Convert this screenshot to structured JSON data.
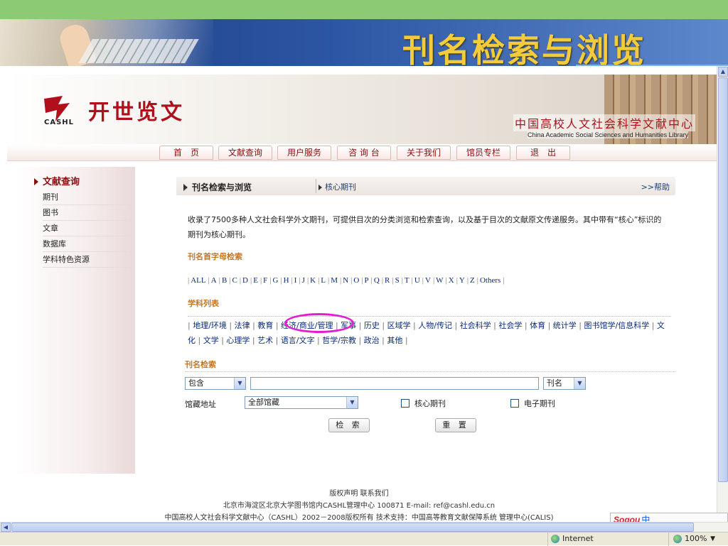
{
  "slide": {
    "title": "刊名检索与浏览"
  },
  "site": {
    "logo_text": "开世览文",
    "logo_sub": "CASHL",
    "center_name": "中国高校人文社会科学文献中心",
    "center_en": "China Academic Social Sciences and Humanities Library"
  },
  "nav": [
    {
      "label": "首　页"
    },
    {
      "label": "文献查询"
    },
    {
      "label": "用户服务"
    },
    {
      "label": "咨 询 台"
    },
    {
      "label": "关于我们"
    },
    {
      "label": "馆员专栏"
    },
    {
      "label": "退　出"
    }
  ],
  "sidebar": {
    "title": "文献查询",
    "items": [
      {
        "label": "期刊"
      },
      {
        "label": "图书"
      },
      {
        "label": "文章"
      },
      {
        "label": "数据库"
      },
      {
        "label": "学科特色资源"
      }
    ]
  },
  "panel": {
    "title": "刊名检索与浏览",
    "subtitle": "核心期刊",
    "help": ">>帮助",
    "intro": "收录了7500多种人文社会科学外文期刊，可提供目次的分类浏览和检索查询，以及基于目次的文献原文传递服务。其中带有“核心”标识的期刊为核心期刊。"
  },
  "letter_section": {
    "title": "刊名首字母检索",
    "letters": [
      "ALL",
      "A",
      "B",
      "C",
      "D",
      "E",
      "F",
      "G",
      "H",
      "I",
      "J",
      "K",
      "L",
      "M",
      "N",
      "O",
      "P",
      "Q",
      "R",
      "S",
      "T",
      "U",
      "V",
      "W",
      "X",
      "Y",
      "Z",
      "Others"
    ]
  },
  "subject_section": {
    "title": "学科列表",
    "subjects": [
      "地理/环境",
      "法律",
      "教育",
      "经济/商业/管理",
      "军事",
      "历史",
      "区域学",
      "人物/传记",
      "社会科学",
      "社会学",
      "体育",
      "统计学",
      "图书馆学/信息科学",
      "文化",
      "文学",
      "心理学",
      "艺术",
      "语言/文字",
      "哲学/宗教",
      "政治",
      "其他"
    ]
  },
  "search": {
    "title": "刊名检索",
    "match_select": "包含",
    "field_select": "刊名",
    "query_value": "",
    "location_label": "馆藏地址",
    "location_select": "全部馆藏",
    "checkbox_core": "核心期刊",
    "checkbox_electronic": "电子期刊",
    "search_button": "检 索",
    "reset_button": "重 置"
  },
  "footer": {
    "line1": "版权声明  联系我们",
    "line2": "北京市海淀区北京大学图书馆内CASHL管理中心  100871 E-mail: ref@cashl.edu.cn",
    "line3": "中国高校人文社会科学文献中心（CASHL）2002－2008版权所有  技术支持：中国高等教育文献保障系统  管理中心(CALIS)"
  },
  "ime": {
    "logo": "Sogou",
    "mode": "中"
  },
  "statusbar": {
    "zone": "Internet",
    "zoom": "100%"
  },
  "colors": {
    "brand_red": "#b0101b",
    "section_orange": "#c77620",
    "link_blue": "#0a2a7a",
    "highlight_magenta": "#e020d0",
    "banner_gold": "#f2cc3c"
  }
}
